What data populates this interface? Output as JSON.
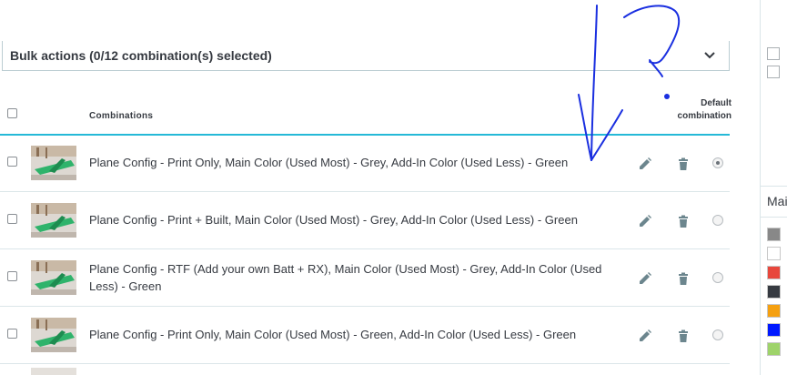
{
  "bulk_actions": {
    "label": "Bulk actions (0/12 combination(s) selected)"
  },
  "table": {
    "header_combinations": "Combinations",
    "header_default_line1": "Default",
    "header_default_line2": "combination",
    "rows": [
      {
        "name": "Plane Config - Print Only, Main Color (Used Most) - Grey, Add-In Color (Used Less) - Green",
        "is_default": true
      },
      {
        "name": "Plane Config - Print + Built, Main Color (Used Most) - Grey, Add-In Color (Used Less) - Green",
        "is_default": false
      },
      {
        "name_line1": "Plane Config - RTF (Add your own Batt + RX), Main Color (Used Most) - Grey, Add-In Color (Used",
        "name_line2": "Less) - Green",
        "is_default": false
      },
      {
        "name": "Plane Config - Print Only, Main Color (Used Most) - Green, Add-In Color (Used Less) - Green",
        "is_default": false
      }
    ]
  },
  "right_panel": {
    "label": "Mai",
    "swatches": [
      "#888888",
      "#ffffff",
      "#e8473c",
      "#363a41",
      "#f5a010",
      "#0019ff",
      "#9ed36a"
    ]
  },
  "colors": {
    "accent": "#25b9d7",
    "annotation_ink": "#1a2fe0"
  },
  "icons": {
    "edit": "pencil-icon",
    "delete": "trash-icon",
    "collapse": "chevron-down-icon"
  }
}
